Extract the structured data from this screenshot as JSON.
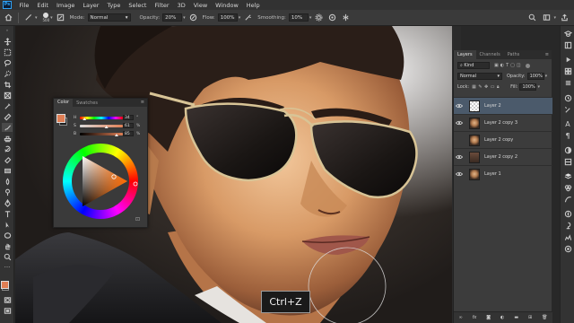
{
  "menu": [
    "File",
    "Edit",
    "Image",
    "Layer",
    "Type",
    "Select",
    "Filter",
    "3D",
    "View",
    "Window",
    "Help"
  ],
  "options": {
    "brush_size": "500",
    "mode_label": "Mode:",
    "mode_value": "Normal",
    "opacity_label": "Opacity:",
    "opacity_value": "20%",
    "flow_label": "Flow:",
    "flow_value": "100%",
    "smoothing_label": "Smoothing:",
    "smoothing_value": "10%"
  },
  "color_panel": {
    "tabs": [
      "Color",
      "Swatches"
    ],
    "sliders": [
      {
        "label": "H",
        "value": "34",
        "unit": "°",
        "fill": 0.09
      },
      {
        "label": "S",
        "value": "61",
        "unit": "%",
        "fill": 0.61
      },
      {
        "label": "B",
        "value": "85",
        "unit": "%",
        "fill": 0.85
      }
    ],
    "foreground": "#e07f55",
    "background": "#1e1e1e"
  },
  "layers_panel": {
    "tabs": [
      "Layers",
      "Channels",
      "Paths"
    ],
    "filter_label": "Kind",
    "blend_mode": "Normal",
    "opacity_label": "Opacity:",
    "opacity_value": "100%",
    "lock_label": "Lock:",
    "fill_label": "Fill:",
    "fill_value": "100%",
    "layers": [
      {
        "name": "Layer 2",
        "visible": true,
        "selected": true,
        "thumb": "trans"
      },
      {
        "name": "Layer 2 copy 3",
        "visible": true,
        "selected": false,
        "thumb": "face"
      },
      {
        "name": "Layer 2 copy",
        "visible": false,
        "selected": false,
        "thumb": "face"
      },
      {
        "name": "Layer 2 copy 2",
        "visible": true,
        "selected": false,
        "thumb": "dark"
      },
      {
        "name": "Layer 1",
        "visible": true,
        "selected": false,
        "thumb": "face"
      }
    ],
    "bottom_icons": [
      "link-icon",
      "fx-icon",
      "mask-icon",
      "adjustment-icon",
      "group-icon",
      "new-layer-icon",
      "trash-icon"
    ]
  },
  "shortcut_overlay": "Ctrl+Z",
  "colors": {
    "accent": "#2fa3f7",
    "selected_layer": "#4b5a6b"
  }
}
